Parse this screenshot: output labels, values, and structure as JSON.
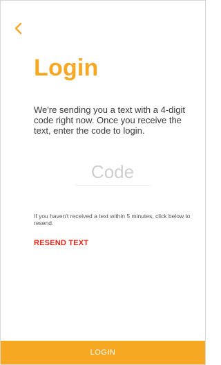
{
  "header": {
    "back_icon": "chevron-left-icon"
  },
  "main": {
    "title": "Login",
    "instructions": "We're sending you a text with a 4-digit code right now. Once you receive the text, enter the code to login.",
    "code_input": {
      "value": "",
      "placeholder": "Code"
    },
    "resend_note": "If you haven't received a text within 5 minutes, click below to resend.",
    "resend_label": "RESEND TEXT"
  },
  "footer": {
    "login_label": "LOGIN"
  },
  "colors": {
    "accent": "#f7a823",
    "resend": "#e2231a",
    "text": "#3a3a3a",
    "placeholder": "#cfcfcf"
  }
}
